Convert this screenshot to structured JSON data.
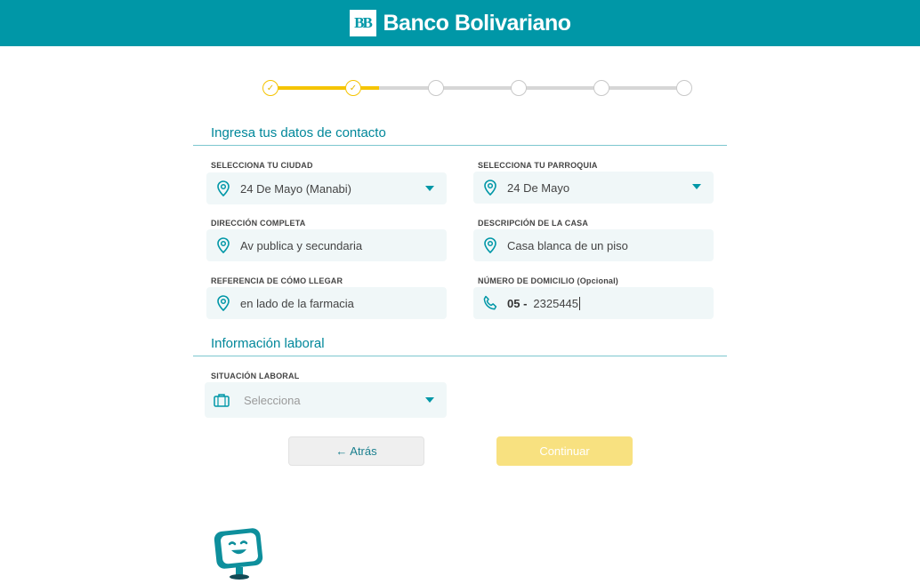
{
  "header": {
    "logo_text": "BB",
    "brand": "Banco Bolivariano"
  },
  "stepper": {
    "total_steps": 6,
    "completed_steps": 2,
    "progress_fraction": 0.27
  },
  "contact": {
    "title": "Ingresa tus datos de contacto",
    "city": {
      "label": "SELECCIONA TU CIUDAD",
      "value": "24 De Mayo (Manabi)"
    },
    "parish": {
      "label": "SELECCIONA TU PARROQUIA",
      "value": "24 De Mayo"
    },
    "address": {
      "label": "DIRECCIÓN COMPLETA",
      "value": "Av publica y secundaria"
    },
    "house": {
      "label": "DESCRIPCIÓN DE LA CASA",
      "value": "Casa blanca de un piso"
    },
    "reference": {
      "label": "REFERENCIA DE CÓMO LLEGAR",
      "value": "en lado de la farmacia"
    },
    "phone": {
      "label": "NÚMERO DE DOMICILIO (Opcional)",
      "prefix": "05 -",
      "value": "2325445"
    }
  },
  "work": {
    "title": "Información laboral",
    "status": {
      "label": "SITUACIÓN LABORAL",
      "placeholder": "Selecciona"
    }
  },
  "buttons": {
    "back": "← Atrás",
    "continue": "Continuar"
  },
  "colors": {
    "brand": "#0097a7",
    "accent": "#f5c400",
    "field_bg": "#f0f7f8"
  },
  "icons": [
    "location-pin-icon",
    "phone-icon",
    "briefcase-icon",
    "chevron-down-icon",
    "check-icon",
    "chat-bot-icon"
  ]
}
